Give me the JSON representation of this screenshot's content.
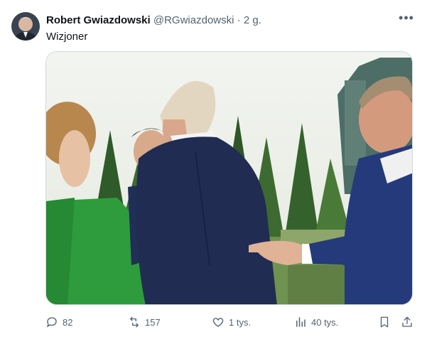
{
  "post": {
    "author_name": "Robert Gwiazdowski",
    "handle": "@RGwiazdowski",
    "separator": "·",
    "time": "2 g.",
    "text": "Wizjoner"
  },
  "actions": {
    "replies": "82",
    "reposts": "157",
    "likes": "1 tys.",
    "views": "40 tys."
  },
  "icons": [
    "more-icon",
    "reply-icon",
    "repost-icon",
    "like-icon",
    "views-icon",
    "bookmark-icon",
    "share-icon"
  ],
  "colors": {
    "secondary_text": "#536471",
    "border": "#cfd9de"
  }
}
